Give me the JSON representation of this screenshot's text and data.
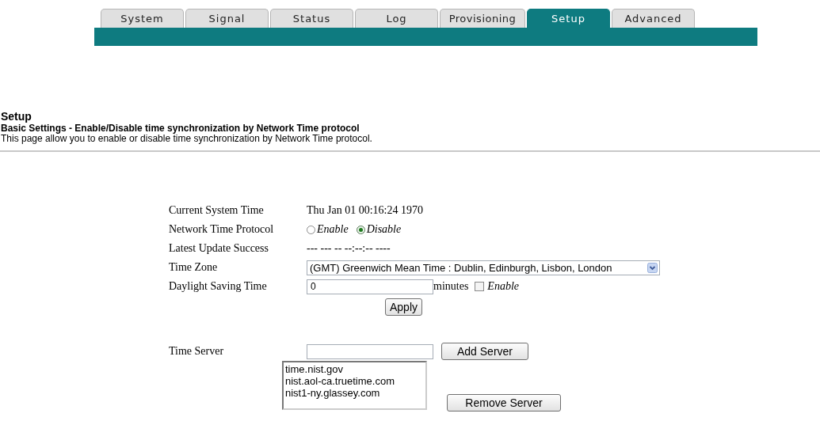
{
  "tabs": [
    {
      "label": "System",
      "selected": false
    },
    {
      "label": "Signal",
      "selected": false
    },
    {
      "label": "Status",
      "selected": false
    },
    {
      "label": "Log",
      "selected": false
    },
    {
      "label": "Provisioning",
      "selected": false
    },
    {
      "label": "Setup",
      "selected": true
    },
    {
      "label": "Advanced",
      "selected": false
    }
  ],
  "page": {
    "title": "Setup",
    "subtitle": "Basic Settings - Enable/Disable time synchronization by Network Time protocol",
    "description": "This page allow you to enable or disable time synchronization by Network Time protocol."
  },
  "form": {
    "current_system_time": {
      "label": "Current System Time",
      "value": "Thu Jan 01 00:16:24 1970"
    },
    "network_time_protocol": {
      "label": "Network Time Protocol",
      "options": [
        {
          "label": "Enable",
          "selected": false
        },
        {
          "label": "Disable",
          "selected": true
        }
      ]
    },
    "latest_update_success": {
      "label": "Latest Update Success",
      "value": "--- --- -- --:--:-- ----"
    },
    "time_zone": {
      "label": "Time Zone",
      "value": "(GMT) Greenwich Mean Time : Dublin, Edinburgh, Lisbon, London"
    },
    "daylight_saving_time": {
      "label": "Daylight Saving Time",
      "value": "0",
      "unit": "minutes",
      "enable": {
        "label": "Enable",
        "checked": false
      }
    },
    "apply_button": "Apply",
    "time_server": {
      "label": "Time Server",
      "add_button": "Add Server",
      "servers": [
        "time.nist.gov",
        "nist.aol-ca.truetime.com",
        "nist1-ny.glassey.com"
      ],
      "remove_button": "Remove Server"
    }
  }
}
